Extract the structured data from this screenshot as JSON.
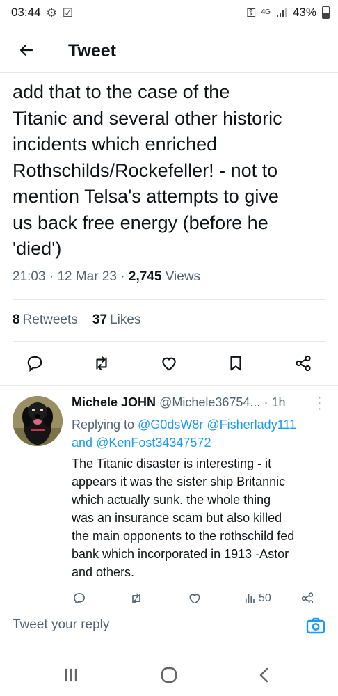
{
  "status_bar": {
    "time": "03:44",
    "network": "4G",
    "battery": "43%"
  },
  "header": {
    "title": "Tweet"
  },
  "tweet": {
    "text_lines": [
      "add that to the case of the",
      "Titanic and several other historic",
      "incidents which enriched",
      "Rothschilds/Rockefeller! - not to",
      "mention Telsa's attempts to give",
      "us back free energy (before he",
      "'died')"
    ],
    "time": "21:03",
    "date": "12 Mar 23",
    "views_count": "2,745",
    "views_label": "Views",
    "retweets_count": "8",
    "retweets_label": "Retweets",
    "likes_count": "37",
    "likes_label": "Likes"
  },
  "reply": {
    "name": "Michele JOHN",
    "handle": "@Michele36754...",
    "time": "1h",
    "replying_prefix": "Replying to",
    "mention1": "@G0dsW8r",
    "mention2": "@Fisherlady111",
    "and_word": "and",
    "mention3": "@KenFost34347572",
    "text_lines": [
      "The Titanic disaster is interesting - it",
      "appears it was the sister ship Britannic",
      "which actually sunk.  the whole thing",
      "was an insurance scam but also killed",
      "the main opponents to the rothschild fed",
      "bank which incorporated in 1913 -Astor",
      "and others."
    ],
    "views": "50"
  },
  "composer": {
    "placeholder": "Tweet your reply"
  },
  "colors": {
    "accent": "#1d9bf0",
    "secondary_text": "#536471",
    "divider": "#e6e6e6"
  }
}
